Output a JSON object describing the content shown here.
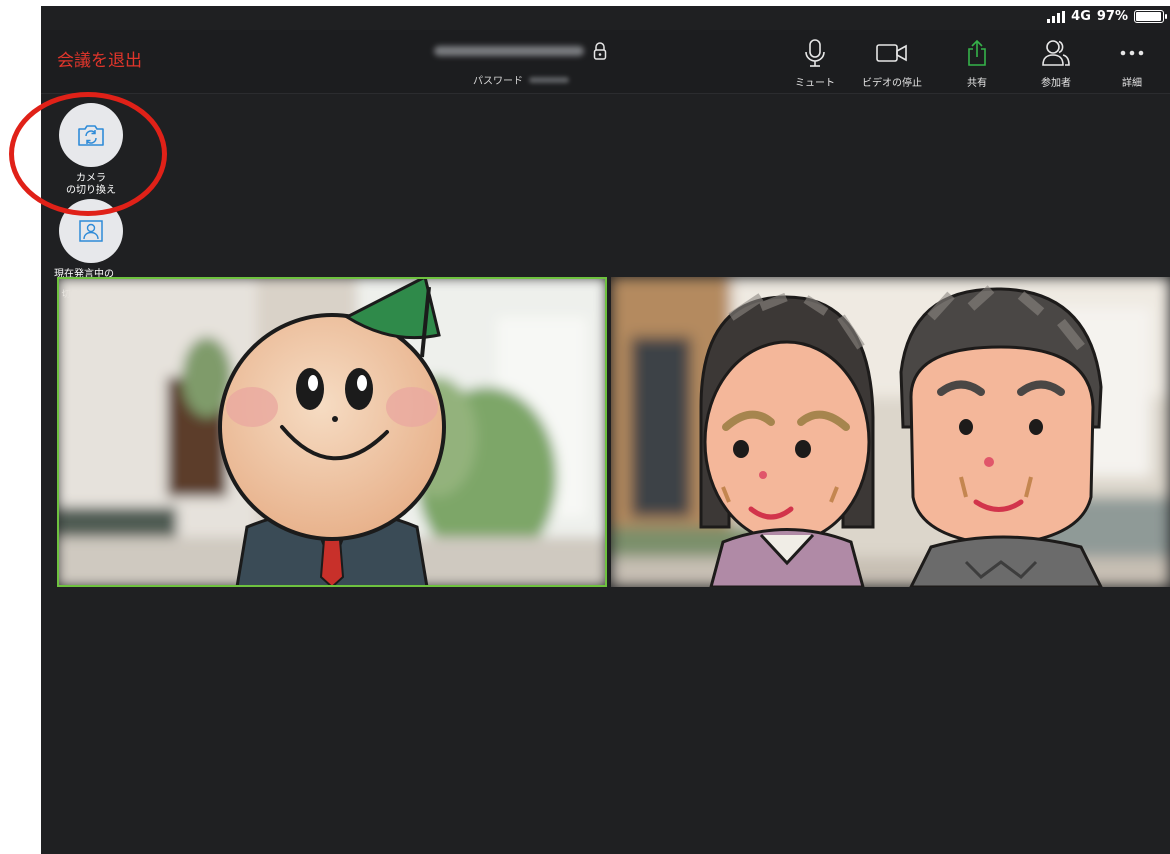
{
  "status_bar": {
    "network": "4G",
    "battery": "97%"
  },
  "toolbar": {
    "leave_label": "会議を退出",
    "password_label": "パスワード",
    "mute_label": "ミュート",
    "stop_video_label": "ビデオの停止",
    "share_label": "共有",
    "participants_label": "参加者",
    "more_label": "詳細"
  },
  "side_controls": {
    "switch_camera_line1": "カメラ",
    "switch_camera_line2": "の切り換え",
    "speaker_view_line1": "現在発言中の",
    "speaker_view_line2": "切り替える"
  },
  "colors": {
    "leave": "#e0352b",
    "share_icon": "#35b34a",
    "active_speaker_border": "#6ec23f",
    "annotation_ring": "#e02118",
    "background": "#1f2022"
  },
  "icons": [
    "lock-icon",
    "microphone-icon",
    "video-camera-icon",
    "share-upload-icon",
    "participants-icon",
    "more-dots-icon",
    "switch-camera-icon",
    "speaker-view-icon"
  ]
}
